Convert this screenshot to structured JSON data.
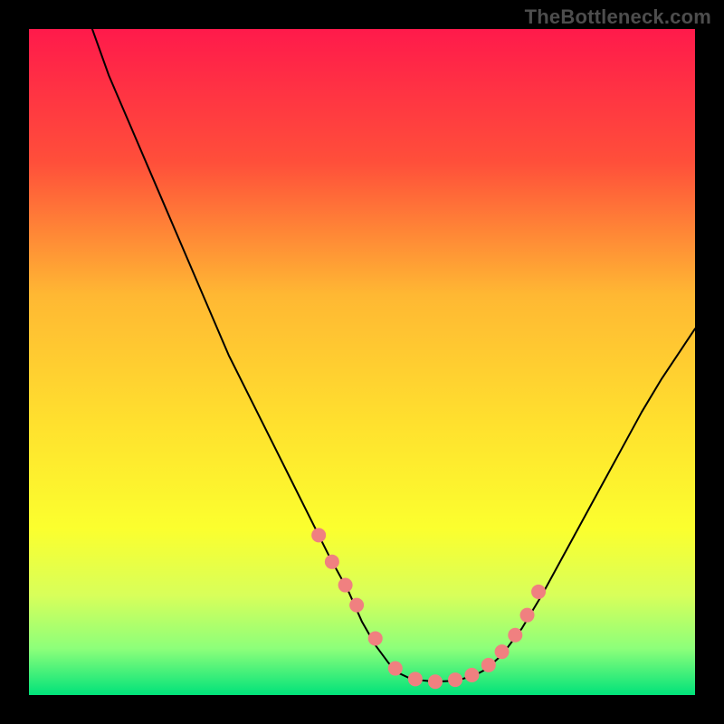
{
  "watermark": "TheBottleneck.com",
  "chart_data": {
    "type": "line",
    "title": "",
    "xlabel": "",
    "ylabel": "",
    "xlim": [
      0,
      100
    ],
    "ylim": [
      0,
      100
    ],
    "grid": false,
    "legend": false,
    "gradient_stops": [
      {
        "offset": 0,
        "color": "#ff1a4b"
      },
      {
        "offset": 20,
        "color": "#ff4f3a"
      },
      {
        "offset": 40,
        "color": "#ffb833"
      },
      {
        "offset": 60,
        "color": "#ffe22e"
      },
      {
        "offset": 75,
        "color": "#fbff2e"
      },
      {
        "offset": 85,
        "color": "#d8ff5a"
      },
      {
        "offset": 93,
        "color": "#8dff7a"
      },
      {
        "offset": 100,
        "color": "#00e27a"
      }
    ],
    "series": [
      {
        "name": "left-branch",
        "x": [
          9.5,
          12,
          15,
          18,
          21,
          24,
          27,
          30,
          33,
          36,
          39,
          42,
          45,
          48,
          50,
          52,
          54,
          55.5
        ],
        "y": [
          100,
          93,
          86,
          79,
          72,
          65,
          58,
          51,
          45,
          39,
          33,
          27,
          21,
          15.5,
          11,
          7.5,
          4.8,
          3.3
        ]
      },
      {
        "name": "valley",
        "x": [
          55.5,
          57,
          59,
          61,
          63,
          65,
          67,
          68.5
        ],
        "y": [
          3.3,
          2.6,
          2.2,
          2.0,
          2.1,
          2.4,
          3.0,
          3.8
        ]
      },
      {
        "name": "right-branch",
        "x": [
          68.5,
          71,
          74,
          77,
          80,
          83,
          86,
          89,
          92,
          95,
          98,
          100
        ],
        "y": [
          3.8,
          6,
          10,
          15,
          20.5,
          26,
          31.5,
          37,
          42.5,
          47.5,
          52,
          55
        ]
      }
    ],
    "markers": {
      "name": "highlight-dots",
      "x": [
        43.5,
        45.5,
        47.5,
        49.2,
        52.0,
        55.0,
        58.0,
        61.0,
        64.0,
        66.5,
        69.0,
        71.0,
        73.0,
        74.8,
        76.5
      ],
      "y": [
        24.0,
        20.0,
        16.5,
        13.5,
        8.5,
        4.0,
        2.4,
        2.0,
        2.3,
        3.0,
        4.5,
        6.5,
        9.0,
        12.0,
        15.5
      ],
      "color": "#f08080",
      "radius_px": 8
    }
  }
}
